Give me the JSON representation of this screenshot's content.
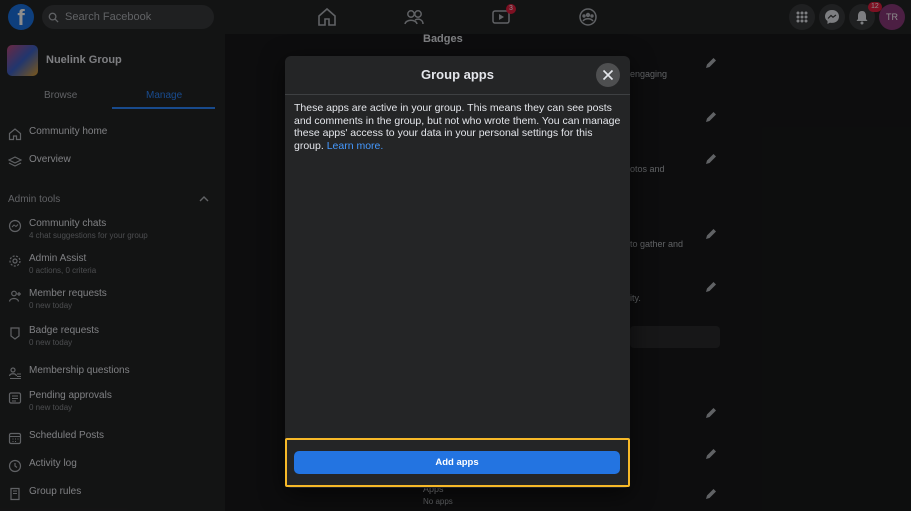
{
  "topbar": {
    "logo_letter": "f",
    "search_placeholder": "Search Facebook",
    "watch_badge": "3",
    "notifications_badge": "12",
    "profile_initials": "TR"
  },
  "sidebar": {
    "group_name": "Nuelink Group",
    "tabs": [
      {
        "label": "Browse"
      },
      {
        "label": "Manage"
      }
    ],
    "top_items": [
      {
        "label": "Community home"
      },
      {
        "label": "Overview"
      }
    ],
    "section_title": "Admin tools",
    "admin_items": [
      {
        "label": "Community chats",
        "sub": "4 chat suggestions for your group"
      },
      {
        "label": "Admin Assist",
        "sub": "0 actions, 0 criteria"
      },
      {
        "label": "Member requests",
        "sub": "0 new today"
      },
      {
        "label": "Badge requests",
        "sub": "0 new today"
      },
      {
        "label": "Membership questions",
        "sub": ""
      },
      {
        "label": "Pending approvals",
        "sub": "0 new today"
      },
      {
        "label": "Scheduled Posts",
        "sub": ""
      },
      {
        "label": "Activity log",
        "sub": ""
      },
      {
        "label": "Group rules",
        "sub": ""
      }
    ]
  },
  "background": {
    "section_heading": "Badges",
    "fragments": [
      "engaging",
      "otos and",
      "to gather and",
      "ity."
    ],
    "apps_label": "Apps",
    "apps_sub": "No apps"
  },
  "modal": {
    "title": "Group apps",
    "body": "These apps are active in your group. This means they can see posts and comments in the group, but not who wrote them. You can manage these apps' access to your data in your personal settings for this group.",
    "learn_more": "Learn more.",
    "add_button": "Add apps"
  },
  "colors": {
    "accent": "#2374e1",
    "highlight": "#f7b928"
  }
}
